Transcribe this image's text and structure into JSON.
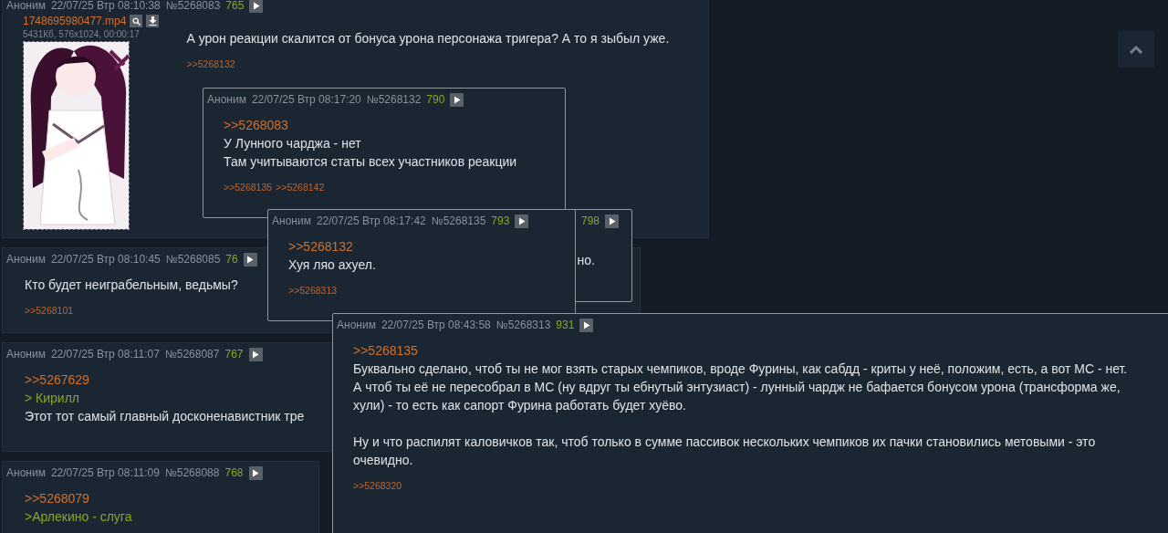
{
  "posts": [
    {
      "author": "Аноним",
      "date": "22/07/25 Втр 08:10:38",
      "number": "№5268083",
      "score": "765",
      "file": {
        "name": "1748695980477.mp4",
        "info": "5431Кб, 576x1024, 00:00:17",
        "kind": "picture"
      },
      "body": [
        {
          "kind": "text",
          "text": "А урон реакции скалится от бонуса урона персонажа тригера? А то я зыбыл уже."
        }
      ],
      "replies": [
        ">>5268132"
      ]
    },
    {
      "author": "Аноним",
      "date": "22/07/25 Втр 08:10:45",
      "number": "№5268085",
      "score": "76",
      "body": [
        {
          "kind": "text",
          "text": "Кто будет неиграбельным, ведьмы?"
        }
      ],
      "replies": [
        ">>5268101"
      ]
    },
    {
      "author": "Аноним",
      "date": "22/07/25 Втр 08:11:07",
      "number": "№5268087",
      "score": "767",
      "body": [
        {
          "kind": "link",
          "text": ">>5267629"
        },
        {
          "kind": "quote",
          "text": "> Кирилл"
        },
        {
          "kind": "text",
          "text": "Этот тот самый главный досконенавистник тре"
        }
      ]
    },
    {
      "author": "Аноним",
      "date": "22/07/25 Втр 08:11:09",
      "number": "№5268088",
      "score": "768",
      "body": [
        {
          "kind": "link",
          "text": ">>5268079"
        },
        {
          "kind": "quote",
          "text": ">Арлекино - слуга"
        }
      ]
    }
  ],
  "popups": [
    {
      "author": "Аноним",
      "date": "22/07/25 Втр 08:17:20",
      "number": "№5268132",
      "score": "790",
      "body": [
        {
          "kind": "link",
          "text": ">>5268083"
        },
        {
          "kind": "text",
          "text": "У Лунного чарджа - нет"
        },
        {
          "kind": "text",
          "text": "Там учитываются статы всех участников реакции"
        }
      ],
      "replies": [
        ">>5268135",
        ">>5268142"
      ]
    },
    {
      "author": "Аноним",
      "date": "22/07/25 Втр 08:17:42",
      "number": "№5268135",
      "score": "793",
      "body": [
        {
          "kind": "link",
          "text": ">>5268132"
        },
        {
          "kind": "text",
          "text": "Хуя ляо ахуел."
        }
      ],
      "replies": [
        ">>5268313"
      ]
    },
    {
      "score": "798",
      "body": [
        {
          "kind": "text",
          "text": "но."
        }
      ]
    },
    {
      "author": "Аноним",
      "date": "22/07/25 Втр 08:43:58",
      "number": "№5268313",
      "score": "931",
      "body": [
        {
          "kind": "link",
          "text": ">>5268135"
        },
        {
          "kind": "text",
          "text": "Буквально сделано, чтоб ты не мог взять старых чемпиков, вроде Фурины, как сабдд - криты у неё, положим, есть, а вот МС - нет."
        },
        {
          "kind": "text",
          "text": "А чтоб ты её не пересобрал в МС (ну вдруг ты ебнутый энтузиаст) - лунный чардж не бафается бонусом урона (трансформа же, хули) - то есть как сапорт Фурина работать будет хуёво."
        },
        {
          "kind": "paragraph",
          "text": "Ну и что распилят каловичков так, чтоб только в сумме пассивок нескольких чемпиков их пачки становились метовыми - это очевидно."
        }
      ],
      "replies": [
        ">>5268320"
      ]
    }
  ]
}
